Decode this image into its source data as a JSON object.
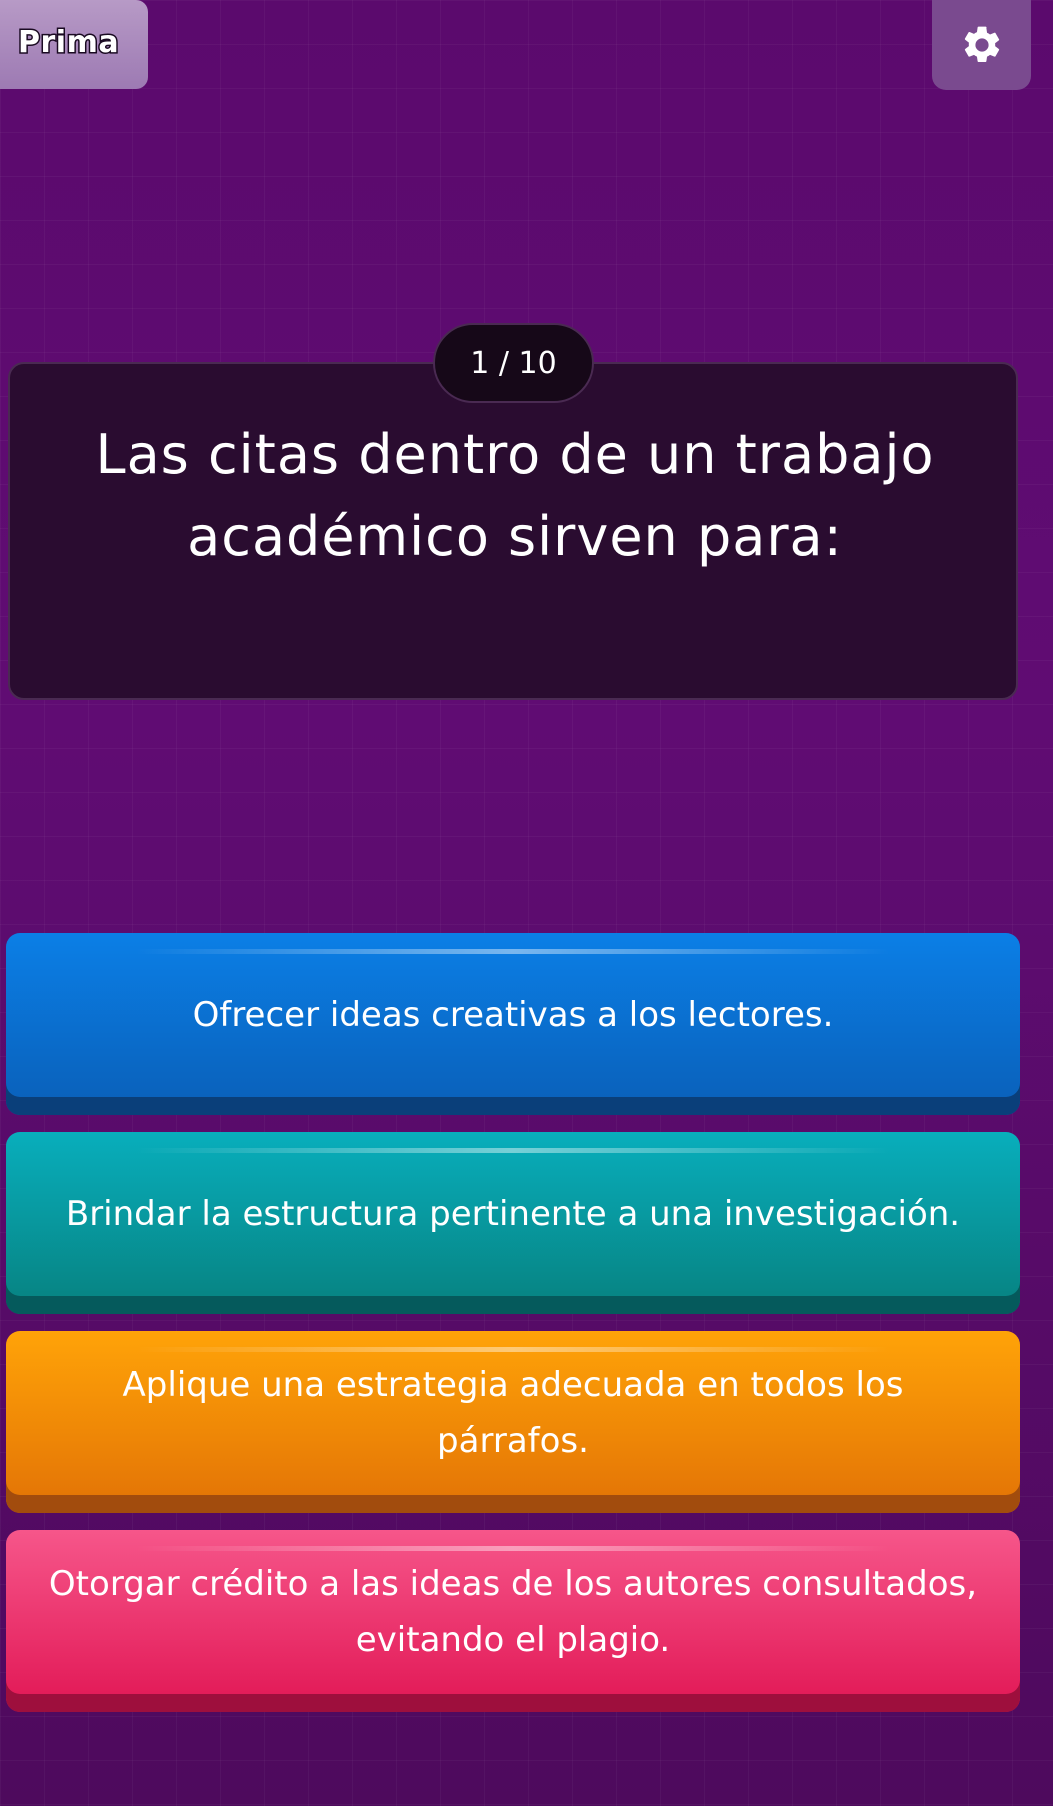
{
  "header": {
    "badge_label": "Prima",
    "settings_icon": "gear-icon"
  },
  "question": {
    "counter": "1 / 10",
    "text": "Las citas dentro de un trabajo académico sirven para:"
  },
  "answers": [
    {
      "label": "Ofrecer ideas creativas a los lectores.",
      "color": "#0b7fe6"
    },
    {
      "label": "Brindar la estructura pertinente a una investigación.",
      "color": "#08aebc"
    },
    {
      "label": "Aplique una estrategia adecuada en todos los párrafos.",
      "color": "#ffa308"
    },
    {
      "label": "Otorgar crédito a las ideas de los autores consultados, evitando el plagio.",
      "color": "#f6568a"
    }
  ],
  "colors": {
    "background": "#5a0c6b",
    "question_card": "#2a0c30"
  }
}
